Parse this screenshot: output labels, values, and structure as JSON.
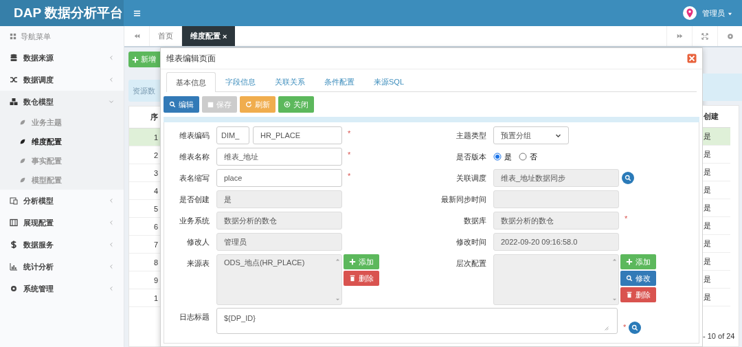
{
  "header": {
    "logo": "DAP 数据分析平台",
    "user": "管理员"
  },
  "sidebar": {
    "heading": "导航菜单",
    "items": [
      {
        "label": "数据来源",
        "expanded": false
      },
      {
        "label": "数据调度",
        "expanded": false
      },
      {
        "label": "数仓模型",
        "expanded": true,
        "children": [
          {
            "label": "业务主题",
            "selected": false
          },
          {
            "label": "维度配置",
            "selected": true
          },
          {
            "label": "事实配置",
            "selected": false
          },
          {
            "label": "模型配置",
            "selected": false
          }
        ]
      },
      {
        "label": "分析模型",
        "expanded": false
      },
      {
        "label": "展现配置",
        "expanded": false
      },
      {
        "label": "数据服务",
        "expanded": false
      },
      {
        "label": "统计分析",
        "expanded": false
      },
      {
        "label": "系统管理",
        "expanded": false
      }
    ]
  },
  "tabs": [
    {
      "label": "首页",
      "selected": false
    },
    {
      "label": "维度配置",
      "selected": true,
      "close": "×"
    }
  ],
  "background": {
    "add_button": "新增",
    "alert": "资源数",
    "table": {
      "left_header": "序",
      "right_header": "创建",
      "rows": [
        {
          "index": "1",
          "value": "是",
          "selected": true
        },
        {
          "index": "2",
          "value": "是",
          "selected": false
        },
        {
          "index": "3",
          "value": "是",
          "selected": false
        },
        {
          "index": "4",
          "value": "是",
          "selected": false
        },
        {
          "index": "5",
          "value": "是",
          "selected": false
        },
        {
          "index": "6",
          "value": "是",
          "selected": false
        },
        {
          "index": "7",
          "value": "是",
          "selected": false
        },
        {
          "index": "8",
          "value": "是",
          "selected": false
        },
        {
          "index": "9",
          "value": "是",
          "selected": false
        },
        {
          "index": "1",
          "value": "是",
          "selected": false
        }
      ]
    },
    "pager": "- 10 of 24"
  },
  "modal": {
    "title": "维表编辑页面",
    "tabs": [
      {
        "label": "基本信息",
        "selected": true
      },
      {
        "label": "字段信息",
        "selected": false
      },
      {
        "label": "关联关系",
        "selected": false
      },
      {
        "label": "条件配置",
        "selected": false
      },
      {
        "label": "来源SQL",
        "selected": false
      }
    ],
    "toolbar": [
      {
        "label": "编辑",
        "kind": "edit",
        "disabled": false
      },
      {
        "label": "保存",
        "kind": "save",
        "disabled": true
      },
      {
        "label": "刷新",
        "kind": "refresh",
        "disabled": false
      },
      {
        "label": "关闭",
        "kind": "close",
        "disabled": false
      }
    ],
    "left": [
      {
        "label": "维表编码",
        "kind": "prefixed",
        "prefix": "DIM_",
        "value": "HR_PLACE",
        "required_mark": "*"
      },
      {
        "label": "维表名称",
        "kind": "text",
        "value": "维表_地址",
        "disabled": false,
        "required_mark": "*"
      },
      {
        "label": "表名缩写",
        "kind": "text",
        "value": "place",
        "disabled": false,
        "required_mark": "*"
      },
      {
        "label": "是否创建",
        "kind": "text",
        "value": "是",
        "disabled": true
      },
      {
        "label": "业务系统",
        "kind": "text",
        "value": "数据分析的数仓",
        "disabled": true
      },
      {
        "label": "修改人",
        "kind": "text",
        "value": "管理员",
        "disabled": true
      },
      {
        "label": "来源表",
        "kind": "list",
        "options": [
          "ODS_地点(HR_PLACE)"
        ],
        "buttons": [
          {
            "label": "添加",
            "kind": "add"
          },
          {
            "label": "删除",
            "kind": "delete"
          }
        ]
      }
    ],
    "right": [
      {
        "label": "主题类型",
        "kind": "select",
        "value": "预置分组"
      },
      {
        "label": "是否版本",
        "kind": "radio",
        "options": [
          {
            "label": "是",
            "selected": true
          },
          {
            "label": "否",
            "selected": false
          }
        ]
      },
      {
        "label": "关联调度",
        "kind": "text",
        "value": "维表_地址数据同步",
        "disabled": true,
        "lookup": true
      },
      {
        "label": "最新同步时间",
        "kind": "text",
        "disabled": true
      },
      {
        "label": "数据库",
        "kind": "text",
        "value": "数据分析的数仓",
        "disabled": true,
        "required_mark": "*"
      },
      {
        "label": "修改时间",
        "kind": "text",
        "value": "2022-09-20 09:16:58.0",
        "disabled": true
      },
      {
        "label": "层次配置",
        "kind": "list",
        "buttons": [
          {
            "label": "添加",
            "kind": "add"
          },
          {
            "label": "修改",
            "kind": "edit"
          },
          {
            "label": "删除",
            "kind": "delete"
          }
        ]
      }
    ],
    "full": {
      "label": "日志标题",
      "value": "${DP_ID}",
      "required_mark": "*",
      "lookup": true
    }
  }
}
